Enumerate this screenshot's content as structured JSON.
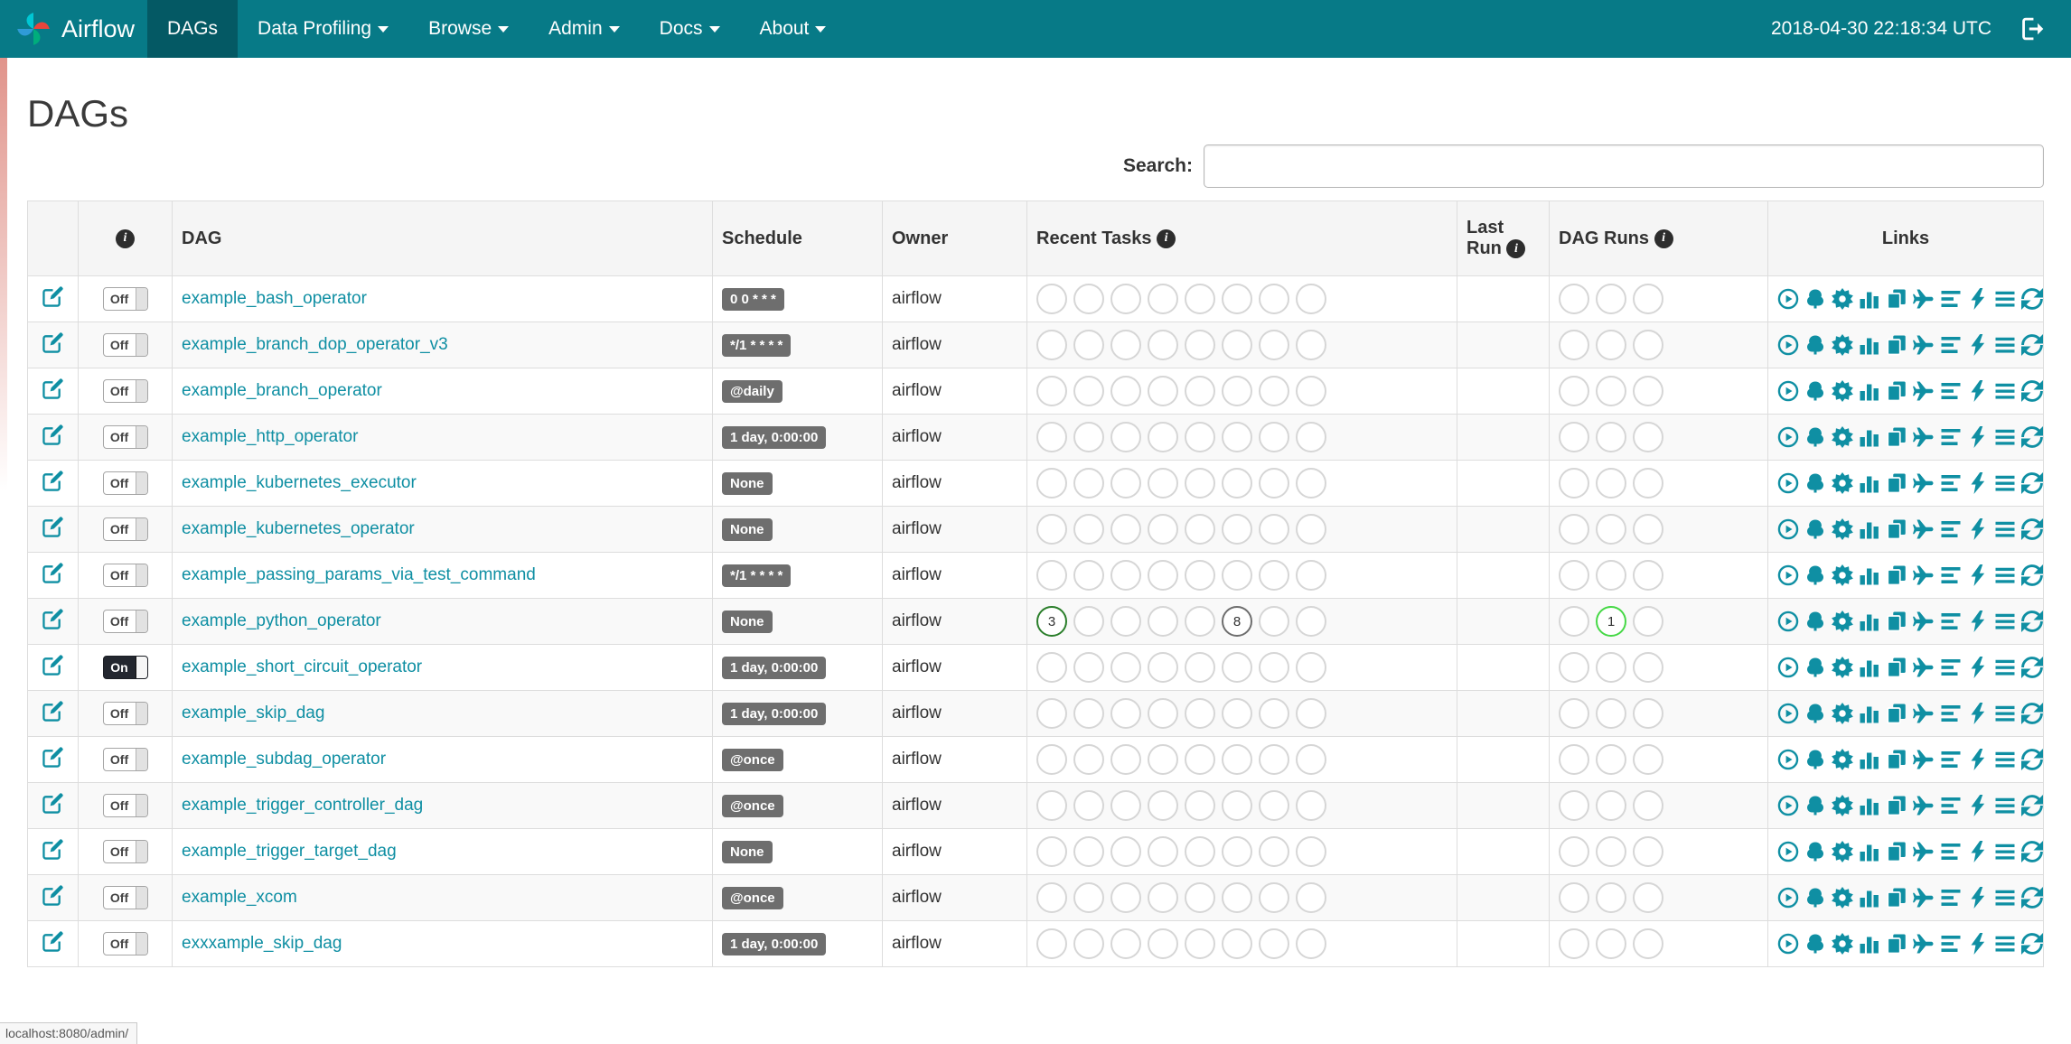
{
  "navbar": {
    "brand": "Airflow",
    "logo_icon": "airflow-pinwheel-logo-icon",
    "items": [
      {
        "label": "DAGs",
        "active": true,
        "dropdown": false
      },
      {
        "label": "Data Profiling",
        "active": false,
        "dropdown": true
      },
      {
        "label": "Browse",
        "active": false,
        "dropdown": true
      },
      {
        "label": "Admin",
        "active": false,
        "dropdown": true
      },
      {
        "label": "Docs",
        "active": false,
        "dropdown": true
      },
      {
        "label": "About",
        "active": false,
        "dropdown": true
      }
    ],
    "clock": "2018-04-30 22:18:34 UTC",
    "logout_icon": "logout-icon"
  },
  "page": {
    "title": "DAGs",
    "search_label": "Search:",
    "search_value": "",
    "status_bar": "localhost:8080/admin/"
  },
  "table": {
    "headers": {
      "dag": "DAG",
      "schedule": "Schedule",
      "owner": "Owner",
      "recent_tasks": "Recent Tasks",
      "last_run": "Last Run",
      "dag_runs": "DAG Runs",
      "links": "Links"
    },
    "info_icon": "info-icon",
    "row_edit_icon": "edit-dag-icon",
    "links_icons": [
      "trigger-dag-icon",
      "tree-view-icon",
      "graph-view-icon",
      "task-duration-icon",
      "task-tries-icon",
      "landing-times-icon",
      "gantt-view-icon",
      "code-view-icon",
      "dag-details-icon",
      "refresh-icon"
    ],
    "recent_task_slots": 8,
    "dag_run_slots": 3,
    "colors": {
      "accent_teal": "#0f8fa3",
      "success_green": "#2a7e2a",
      "running_green": "#46d846",
      "neutral_gray": "#6e6e6e"
    },
    "rows": [
      {
        "dag_id": "example_bash_operator",
        "schedule": "0 0 * * *",
        "owner": "airflow",
        "paused": true,
        "toggle_label": "Off",
        "last_run": "",
        "recent_tasks": [],
        "dag_runs": []
      },
      {
        "dag_id": "example_branch_dop_operator_v3",
        "schedule": "*/1 * * * *",
        "owner": "airflow",
        "paused": true,
        "toggle_label": "Off",
        "last_run": "",
        "recent_tasks": [],
        "dag_runs": []
      },
      {
        "dag_id": "example_branch_operator",
        "schedule": "@daily",
        "owner": "airflow",
        "paused": true,
        "toggle_label": "Off",
        "last_run": "",
        "recent_tasks": [],
        "dag_runs": []
      },
      {
        "dag_id": "example_http_operator",
        "schedule": "1 day, 0:00:00",
        "owner": "airflow",
        "paused": true,
        "toggle_label": "Off",
        "last_run": "",
        "recent_tasks": [],
        "dag_runs": []
      },
      {
        "dag_id": "example_kubernetes_executor",
        "schedule": "None",
        "owner": "airflow",
        "paused": true,
        "toggle_label": "Off",
        "last_run": "",
        "recent_tasks": [],
        "dag_runs": []
      },
      {
        "dag_id": "example_kubernetes_operator",
        "schedule": "None",
        "owner": "airflow",
        "paused": true,
        "toggle_label": "Off",
        "last_run": "",
        "recent_tasks": [],
        "dag_runs": []
      },
      {
        "dag_id": "example_passing_params_via_test_command",
        "schedule": "*/1 * * * *",
        "owner": "airflow",
        "paused": true,
        "toggle_label": "Off",
        "last_run": "",
        "recent_tasks": [],
        "dag_runs": []
      },
      {
        "dag_id": "example_python_operator",
        "schedule": "None",
        "owner": "airflow",
        "paused": true,
        "toggle_label": "Off",
        "last_run": "",
        "recent_tasks": [
          {
            "pos": 0,
            "count": "3",
            "state_color": "#2a7e2a"
          },
          {
            "pos": 5,
            "count": "8",
            "state_color": "#6e6e6e"
          }
        ],
        "dag_runs": [
          {
            "pos": 1,
            "count": "1",
            "state_color": "#46d846"
          }
        ]
      },
      {
        "dag_id": "example_short_circuit_operator",
        "schedule": "1 day, 0:00:00",
        "owner": "airflow",
        "paused": false,
        "toggle_label": "On",
        "last_run": "",
        "recent_tasks": [],
        "dag_runs": []
      },
      {
        "dag_id": "example_skip_dag",
        "schedule": "1 day, 0:00:00",
        "owner": "airflow",
        "paused": true,
        "toggle_label": "Off",
        "last_run": "",
        "recent_tasks": [],
        "dag_runs": []
      },
      {
        "dag_id": "example_subdag_operator",
        "schedule": "@once",
        "owner": "airflow",
        "paused": true,
        "toggle_label": "Off",
        "last_run": "",
        "recent_tasks": [],
        "dag_runs": []
      },
      {
        "dag_id": "example_trigger_controller_dag",
        "schedule": "@once",
        "owner": "airflow",
        "paused": true,
        "toggle_label": "Off",
        "last_run": "",
        "recent_tasks": [],
        "dag_runs": []
      },
      {
        "dag_id": "example_trigger_target_dag",
        "schedule": "None",
        "owner": "airflow",
        "paused": true,
        "toggle_label": "Off",
        "last_run": "",
        "recent_tasks": [],
        "dag_runs": []
      },
      {
        "dag_id": "example_xcom",
        "schedule": "@once",
        "owner": "airflow",
        "paused": true,
        "toggle_label": "Off",
        "last_run": "",
        "recent_tasks": [],
        "dag_runs": []
      },
      {
        "dag_id": "exxxample_skip_dag",
        "schedule": "1 day, 0:00:00",
        "owner": "airflow",
        "paused": true,
        "toggle_label": "Off",
        "last_run": "",
        "recent_tasks": [],
        "dag_runs": []
      }
    ]
  }
}
